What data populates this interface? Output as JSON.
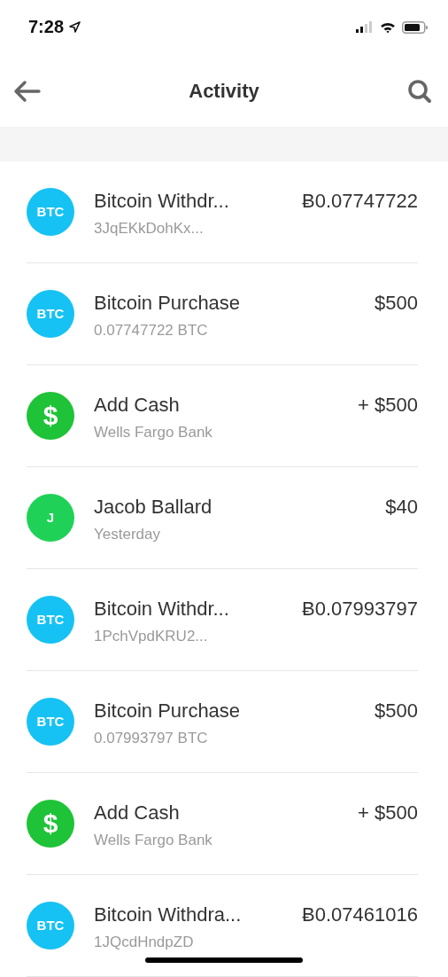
{
  "status_bar": {
    "time": "7:28"
  },
  "nav": {
    "title": "Activity"
  },
  "transactions": [
    {
      "avatar": "BTC",
      "color": "#16c2f3",
      "title": "Bitcoin Withdr...",
      "subtitle": "3JqEKkDohKx...",
      "amount": "Ƀ0.07747722"
    },
    {
      "avatar": "BTC",
      "color": "#16c2f3",
      "title": "Bitcoin Purchase",
      "subtitle": "0.07747722 BTC",
      "amount": "$500"
    },
    {
      "avatar": "$",
      "color": "#1ec337",
      "title": "Add Cash",
      "subtitle": "Wells Fargo Bank",
      "amount": "+ $500"
    },
    {
      "avatar": "J",
      "color": "#1fd257",
      "title": "Jacob Ballard",
      "subtitle": "Yesterday",
      "amount": "$40"
    },
    {
      "avatar": "BTC",
      "color": "#16c2f3",
      "title": "Bitcoin Withdr...",
      "subtitle": "1PchVpdKRU2...",
      "amount": "Ƀ0.07993797"
    },
    {
      "avatar": "BTC",
      "color": "#16c2f3",
      "title": "Bitcoin Purchase",
      "subtitle": "0.07993797 BTC",
      "amount": "$500"
    },
    {
      "avatar": "$",
      "color": "#1ec337",
      "title": "Add Cash",
      "subtitle": "Wells Fargo Bank",
      "amount": "+ $500"
    },
    {
      "avatar": "BTC",
      "color": "#16c2f3",
      "title": "Bitcoin Withdra...",
      "subtitle": "1JQcdHndpZD",
      "amount": "Ƀ0.07461016"
    }
  ]
}
